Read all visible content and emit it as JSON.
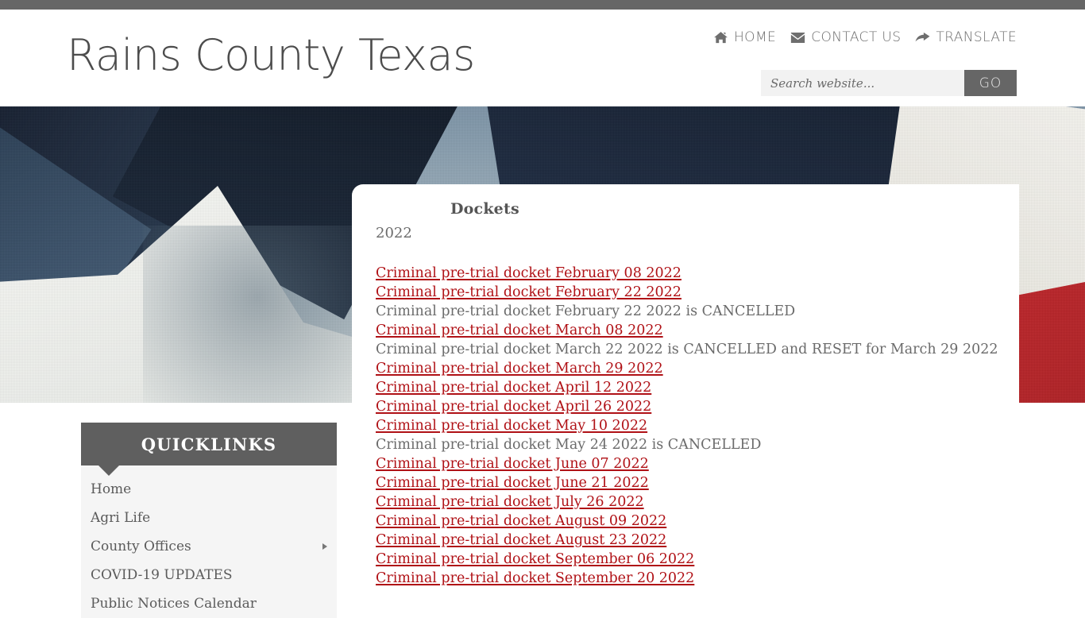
{
  "site": {
    "title": "Rains County Texas"
  },
  "top_nav": {
    "items": [
      {
        "label": "HOME",
        "icon": "home-icon"
      },
      {
        "label": "CONTACT US",
        "icon": "envelope-icon"
      },
      {
        "label": "TRANSLATE",
        "icon": "forward-arrow-icon"
      }
    ]
  },
  "search": {
    "placeholder": "Search website...",
    "value": "",
    "button_label": "GO"
  },
  "main": {
    "heading": "Dockets",
    "year": "2022",
    "entries": [
      {
        "text": "Criminal pre-trial docket February 08 2022",
        "is_link": true
      },
      {
        "text": "Criminal pre-trial docket February 22 2022",
        "is_link": true
      },
      {
        "text": "Criminal pre-trial docket February 22 2022 is CANCELLED",
        "is_link": false
      },
      {
        "text": "Criminal pre-trial docket March 08 2022",
        "is_link": true
      },
      {
        "text": "Criminal pre-trial docket March 22 2022 is CANCELLED and RESET for March 29 2022",
        "is_link": false
      },
      {
        "text": "Criminal pre-trial docket March 29 2022",
        "is_link": true
      },
      {
        "text": "Criminal pre-trial docket April 12 2022",
        "is_link": true
      },
      {
        "text": "Criminal pre-trial docket April 26 2022",
        "is_link": true
      },
      {
        "text": "Criminal pre-trial docket May 10 2022",
        "is_link": true
      },
      {
        "text": "Criminal pre-trial docket May 24 2022 is CANCELLED",
        "is_link": false
      },
      {
        "text": "Criminal pre-trial docket June 07 2022",
        "is_link": true
      },
      {
        "text": "Criminal pre-trial docket June 21 2022",
        "is_link": true
      },
      {
        "text": "Criminal pre-trial docket July 26 2022",
        "is_link": true
      },
      {
        "text": "Criminal pre-trial docket August 09 2022",
        "is_link": true
      },
      {
        "text": "Criminal pre-trial docket August 23 2022",
        "is_link": true
      },
      {
        "text": "Criminal pre-trial docket September 06 2022",
        "is_link": true
      },
      {
        "text": "Criminal pre-trial docket September 20 2022",
        "is_link": true
      }
    ]
  },
  "quicklinks": {
    "title": "QUICKLINKS",
    "items": [
      {
        "label": "Home",
        "has_submenu": false
      },
      {
        "label": "Agri Life",
        "has_submenu": false
      },
      {
        "label": "County Offices",
        "has_submenu": true
      },
      {
        "label": "COVID-19 UPDATES",
        "has_submenu": false
      },
      {
        "label": "Public Notices Calendar",
        "has_submenu": false
      }
    ]
  },
  "colors": {
    "accent_red": "#b01116",
    "header_gray": "#5f5f5f",
    "top_strip": "#666666",
    "text_gray": "#6b6b6b",
    "panel_bg": "#f5f5f5"
  }
}
